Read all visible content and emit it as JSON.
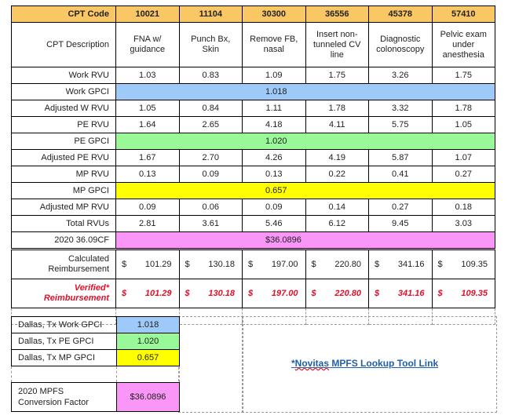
{
  "header": {
    "label": "CPT Code",
    "codes": [
      "10021",
      "11104",
      "30300",
      "36556",
      "45378",
      "57410"
    ]
  },
  "description": {
    "label": "CPT Description",
    "values": [
      "FNA w/ guidance",
      "Punch Bx, Skin",
      "Remove FB, nasal",
      "Insert non-tunneled CV line",
      "Diagnostic colonoscopy",
      "Pelvic exam under anesthesia"
    ]
  },
  "rows": {
    "work_rvu": {
      "label": "Work RVU",
      "values": [
        "1.03",
        "0.83",
        "1.09",
        "1.75",
        "3.26",
        "1.75"
      ]
    },
    "work_gpci": {
      "label": "Work GPCI",
      "value": "1.018",
      "color": "#9dcaf8"
    },
    "adj_w_rvu": {
      "label": "Adjusted W RVU",
      "values": [
        "1.05",
        "0.84",
        "1.11",
        "1.78",
        "3.32",
        "1.78"
      ]
    },
    "pe_rvu": {
      "label": "PE RVU",
      "values": [
        "1.64",
        "2.65",
        "4.18",
        "4.11",
        "5.75",
        "1.05"
      ]
    },
    "pe_gpci": {
      "label": "PE GPCI",
      "value": "1.020",
      "color": "#99f999"
    },
    "adj_pe_rvu": {
      "label": "Adjusted PE RVU",
      "values": [
        "1.67",
        "2.70",
        "4.26",
        "4.19",
        "5.87",
        "1.07"
      ]
    },
    "mp_rvu": {
      "label": "MP RVU",
      "values": [
        "0.13",
        "0.09",
        "0.13",
        "0.22",
        "0.41",
        "0.27"
      ]
    },
    "mp_gpci": {
      "label": "MP GPCI",
      "value": "0.657",
      "color": "#ffff00"
    },
    "adj_mp_rvu": {
      "label": "Adjusted MP RVU",
      "values": [
        "0.09",
        "0.06",
        "0.09",
        "0.14",
        "0.27",
        "0.18"
      ]
    },
    "total_rvus": {
      "label": "Total RVUs",
      "values": [
        "2.81",
        "3.61",
        "5.46",
        "6.12",
        "9.45",
        "3.03"
      ]
    },
    "cf": {
      "label": "2020 36.09CF",
      "value": "$36.0896",
      "color": "#fa96f8"
    },
    "calculated": {
      "label_line1": "Calculated",
      "label_line2": "Reimbursement",
      "currency": "$",
      "values": [
        "101.29",
        "130.18",
        "197.00",
        "220.80",
        "341.16",
        "109.35"
      ]
    },
    "verified": {
      "label_line1": "Verified*",
      "label_line2": "Reimbursement",
      "currency": "$",
      "values": [
        "101.29",
        "130.18",
        "197.00",
        "220.80",
        "341.16",
        "109.35"
      ],
      "color": "#e0102b"
    }
  },
  "summary": {
    "work": {
      "label": "Dallas, Tx Work GPCI",
      "value": "1.018"
    },
    "pe": {
      "label": "Dallas, Tx PE GPCI",
      "value": "1.020"
    },
    "mp": {
      "label": "Dallas, Tx MP GPCI",
      "value": "0.657"
    },
    "conv": {
      "label_line1": "2020 MPFS",
      "label_line2": "Conversion Factor",
      "value": "$36.0896"
    }
  },
  "link": {
    "prefix": "*",
    "word": "Novitas",
    "rest": " MPFS Lookup Tool Link",
    "color": "#1f5fa8"
  }
}
